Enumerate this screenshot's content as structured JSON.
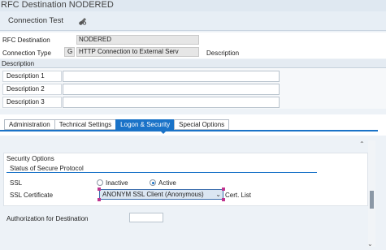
{
  "window": {
    "title": "RFC Destination NODERED"
  },
  "toolbar": {
    "connection_test_label": "Connection Test",
    "icon": "pen-glasses-icon"
  },
  "header": {
    "rfc_destination_label": "RFC Destination",
    "rfc_destination_value": "NODERED",
    "connection_type_label": "Connection Type",
    "connection_type_code": "G",
    "connection_type_value": "HTTP Connection to External Serv",
    "connection_type_desc": "Description"
  },
  "description": {
    "section_title": "Description",
    "rows": [
      {
        "label": "Description 1",
        "value": ""
      },
      {
        "label": "Description 2",
        "value": ""
      },
      {
        "label": "Description 3",
        "value": ""
      }
    ]
  },
  "tabs": [
    {
      "label": "Administration",
      "active": false
    },
    {
      "label": "Technical Settings",
      "active": false
    },
    {
      "label": "Logon & Security",
      "active": true
    },
    {
      "label": "Special Options",
      "active": false
    }
  ],
  "security": {
    "title": "Security Options",
    "status_title": "Status of Secure Protocol",
    "ssl_label": "SSL",
    "inactive_label": "Inactive",
    "active_label": "Active",
    "ssl_active": true,
    "ssl_cert_label": "SSL Certificate",
    "ssl_cert_value": "ANONYM SSL Client (Anonymous)",
    "cert_list_label": "Cert. List",
    "auth_label": "Authorization for Destination",
    "auth_value": ""
  },
  "colors": {
    "accent": "#1a73c8",
    "handle": "#c0358f"
  }
}
